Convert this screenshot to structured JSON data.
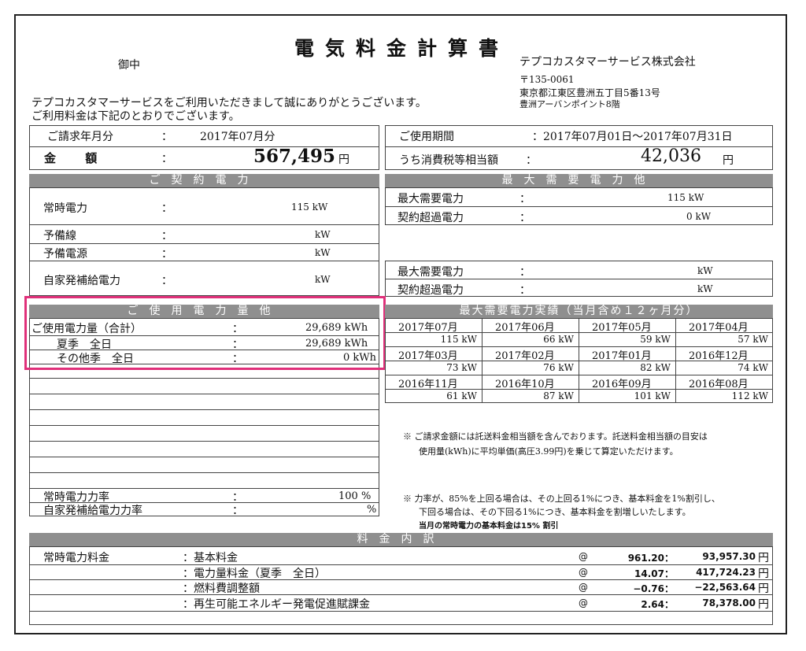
{
  "header": {
    "title": "電気料金計算書",
    "recipient_suffix": "御中",
    "company": "テプコカスタマーサービス株式会社",
    "postal": "〒135-0061",
    "address1": "東京都江東区豊洲五丁目5番13号",
    "address2": "豊洲アーバンポイント8階",
    "greeting1": "テプコカスタマーサービスをご利用いただきまして誠にありがとうございます。",
    "greeting2": "ご利用料金は下記のとおりでございます。"
  },
  "summary": {
    "billing_month_label": "ご請求年月分",
    "billing_month_value": "2017年07月分",
    "amount_label": "金 額",
    "amount_value": "567,495",
    "yen": "円",
    "period_label": "ご使用期間",
    "period_value": "2017年07月01日～2017年07月31日",
    "tax_label": "うち消費税等相当額",
    "tax_value": "42,036",
    "colon": "："
  },
  "contract": {
    "header": "ご契約電力",
    "rows": [
      {
        "label": "常時電力",
        "value": "115 kW"
      },
      {
        "label": "予備線",
        "value": "kW"
      },
      {
        "label": "予備電源",
        "value": "kW"
      },
      {
        "label": "自家発補給電力",
        "value": "kW"
      }
    ]
  },
  "max_demand": {
    "header": "最大需要電力他",
    "rows": [
      {
        "label": "最大需要電力",
        "value": "115 kW"
      },
      {
        "label": "契約超過電力",
        "value": "0 kW"
      },
      {
        "label": "最大需要電力",
        "value": "kW"
      },
      {
        "label": "契約超過電力",
        "value": "kW"
      }
    ]
  },
  "usage": {
    "header": "ご使用電力量他",
    "rows": [
      {
        "label": "ご使用電力量（合計）",
        "value": "29,689 kWh"
      },
      {
        "label": "夏季　全日",
        "value": "29,689 kWh"
      },
      {
        "label": "その他季　全日",
        "value": "0 kWh"
      }
    ],
    "power_factor_label": "常時電力力率",
    "power_factor_value": "100 %",
    "self_pf_label": "自家発補給電力力率",
    "self_pf_value": "%"
  },
  "history": {
    "header": "最大需要電力実績（当月含め１２ヶ月分）",
    "months": [
      "2017年07月",
      "2017年06月",
      "2017年05月",
      "2017年04月",
      "2017年03月",
      "2017年02月",
      "2017年01月",
      "2016年12月",
      "2016年11月",
      "2016年10月",
      "2016年09月",
      "2016年08月"
    ],
    "values": [
      "115 kW",
      "66 kW",
      "59 kW",
      "57 kW",
      "73 kW",
      "76 kW",
      "82 kW",
      "74 kW",
      "61 kW",
      "87 kW",
      "101 kW",
      "112 kW"
    ]
  },
  "notes": {
    "note1_line1": "※ ご請求金額には託送料金相当額を含んでおります。託送料金相当額の目安は",
    "note1_line2": "使用量(kWh)に平均単価(高圧3.99円)を乗じて算定いただけます。",
    "note2_line1": "※ 力率が、85%を上回る場合は、その上回る1%につき、基本料金を1%割引し、",
    "note2_line2": "下回る場合は、その下回る1%につき、基本料金を割増しいたします。",
    "note2_line3": "当月の常時電力の基本料金は15% 割引"
  },
  "breakdown": {
    "header": "料金内訳",
    "category": "常時電力料金",
    "rows": [
      {
        "item": "：基本料金",
        "at": "@",
        "unit": "961.20：",
        "amount": "93,957.30",
        "yen": "円"
      },
      {
        "item": "：電力量料金（夏季　全日）",
        "at": "@",
        "unit": "14.07：",
        "amount": "417,724.23",
        "yen": "円"
      },
      {
        "item": "：燃料費調整額",
        "at": "@",
        "unit": "−0.76：",
        "amount": "−22,563.64",
        "yen": "円"
      },
      {
        "item": "：再生可能エネルギー発電促進賦課金",
        "at": "@",
        "unit": "2.64：",
        "amount": "78,378.00",
        "yen": "円"
      }
    ]
  },
  "highlight_color": "#e0307a"
}
